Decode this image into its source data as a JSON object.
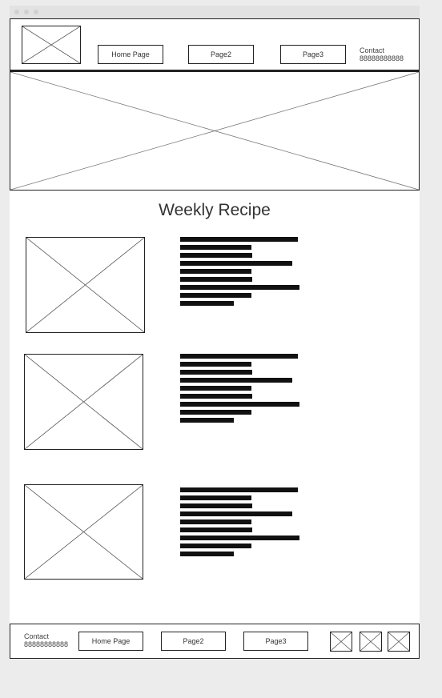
{
  "header": {
    "nav": [
      {
        "label": "Home Page"
      },
      {
        "label": "Page2"
      },
      {
        "label": "Page3"
      }
    ],
    "contact_label": "Contact",
    "contact_phone": "88888888888"
  },
  "main": {
    "title": "Weekly Recipe",
    "recipes": [
      {
        "text_lines": 9
      },
      {
        "text_lines": 9
      },
      {
        "text_lines": 9
      }
    ]
  },
  "footer": {
    "contact_label": "Contact",
    "contact_phone": "88888888888",
    "nav": [
      {
        "label": "Home Page"
      },
      {
        "label": "Page2"
      },
      {
        "label": "Page3"
      }
    ],
    "social_icons": [
      "placeholder-icon",
      "placeholder-icon",
      "placeholder-icon"
    ]
  },
  "colors": {
    "background": "#ececec",
    "page": "#ffffff",
    "outline": "#222222",
    "text_bar": "#111111"
  }
}
